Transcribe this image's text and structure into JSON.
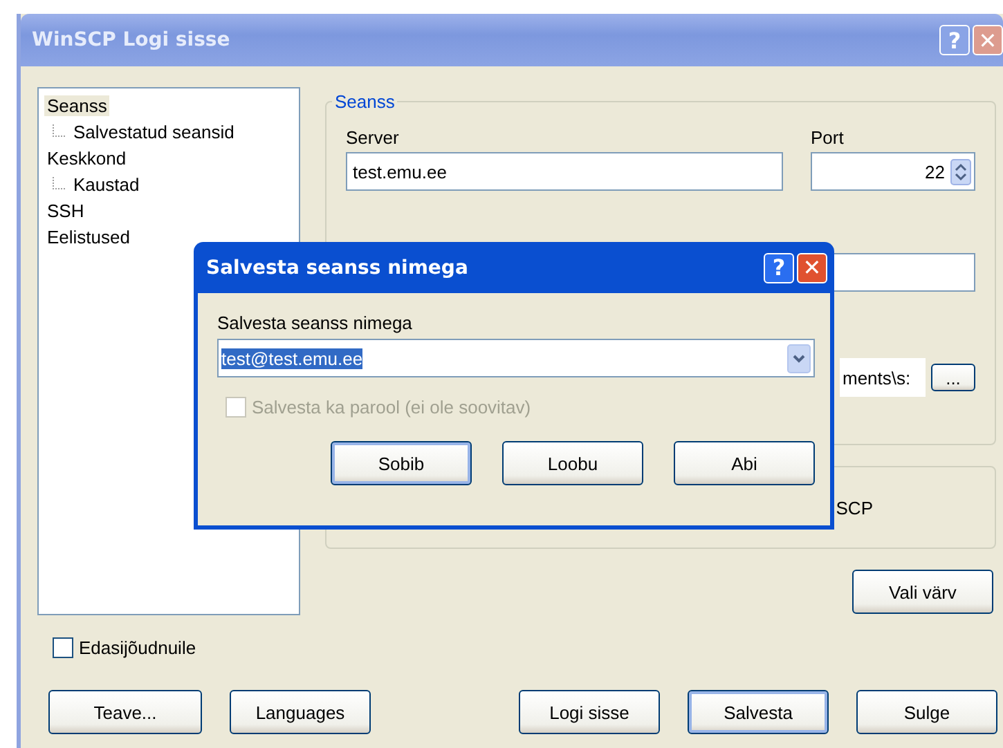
{
  "window": {
    "title": "WinSCP Logi sisse",
    "help": "?",
    "close": "✕"
  },
  "tree": [
    {
      "label": "Seanss",
      "selected": true,
      "children": [
        {
          "label": "Salvestatud seansid",
          "selected": false
        }
      ]
    },
    {
      "label": "Keskkond",
      "selected": false,
      "children": [
        {
          "label": "Kaustad",
          "selected": false
        }
      ]
    },
    {
      "label": "SSH",
      "selected": false
    },
    {
      "label": "Eelistused",
      "selected": false
    }
  ],
  "session_group": {
    "title": "Seanss",
    "server_label": "Server",
    "server": "test.emu.ee",
    "port_label": "Port",
    "port": "22",
    "path_fragment": "ments\\s:",
    "browse_button": "..."
  },
  "second_group": {
    "text_fragment": "SCP"
  },
  "color_button": "Vali värv",
  "advanced": {
    "label": "Edasijõudnuile",
    "checked": false
  },
  "buttons": [
    {
      "label": "Teave...",
      "default": false
    },
    {
      "label": "Languages",
      "default": false
    },
    {
      "label": "Logi sisse",
      "default": false
    },
    {
      "label": "Salvesta",
      "default": true
    },
    {
      "label": "Sulge",
      "default": false
    }
  ],
  "dialog": {
    "title": "Salvesta seanss nimega",
    "label": "Salvesta seanss nimega",
    "value": "test@test.emu.ee",
    "help": "?",
    "close": "✕",
    "password": {
      "label": "Salvesta ka parool (ei ole soovitav)",
      "checked": false,
      "disabled": true
    },
    "buttons": [
      {
        "label": "Sobib",
        "default": true
      },
      {
        "label": "Loobu",
        "default": false
      },
      {
        "label": "Abi",
        "default": false
      }
    ]
  }
}
